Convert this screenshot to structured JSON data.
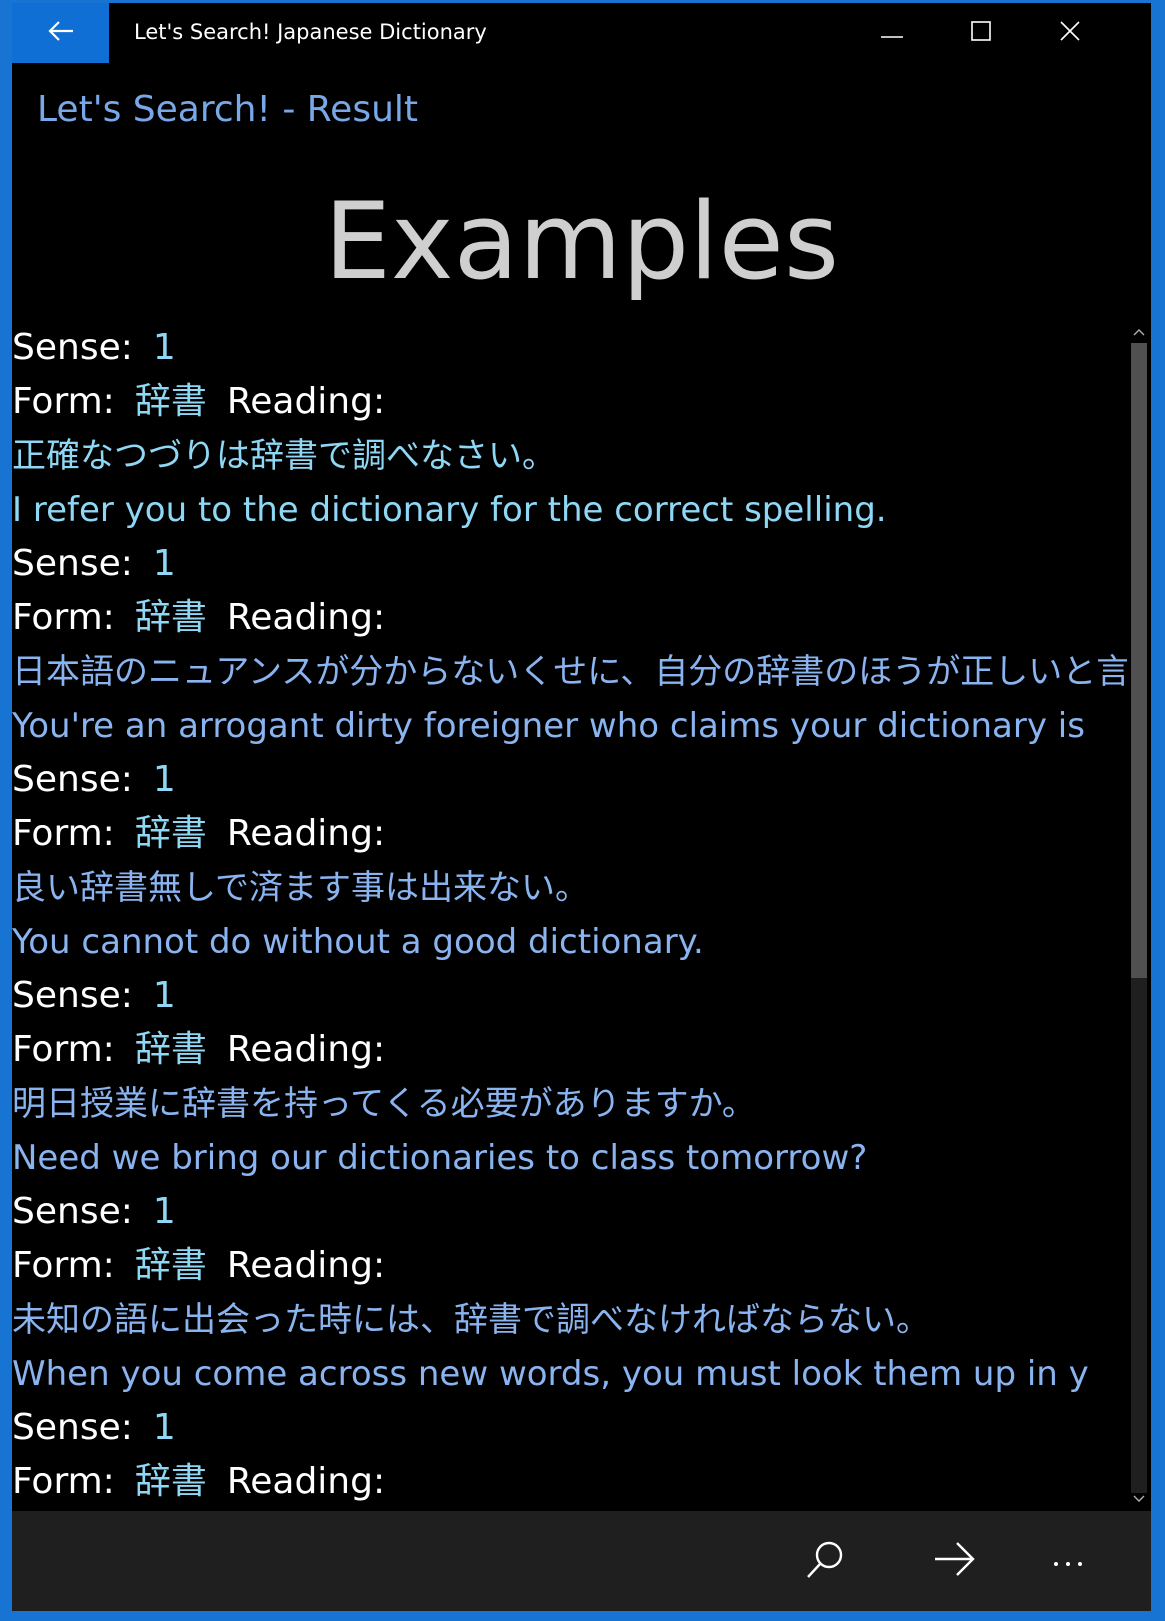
{
  "window": {
    "title": "Let's Search! Japanese Dictionary",
    "accent_color": "#0f6fd4",
    "caption_buttons": [
      "minimize-icon",
      "maximize-icon",
      "close-icon"
    ]
  },
  "app": {
    "header": "Let's Search! - Result",
    "heading": "Examples"
  },
  "labels": {
    "sense": "Sense:",
    "form": "Form:",
    "reading": "Reading:"
  },
  "examples": [
    {
      "sense": "1",
      "form": "辞書",
      "japanese": "正確なつづりは辞書で調べなさい。",
      "english": "I refer you to the dictionary for the correct spelling."
    },
    {
      "sense": "1",
      "form": "辞書",
      "japanese": "日本語のニュアンスが分からないくせに、自分の辞書のほうが正しいと言い",
      "english": "You're an arrogant dirty foreigner who claims your dictionary is"
    },
    {
      "sense": "1",
      "form": "辞書",
      "japanese": "良い辞書無しで済ます事は出来ない。",
      "english": "You cannot do without a good dictionary."
    },
    {
      "sense": "1",
      "form": "辞書",
      "japanese": "明日授業に辞書を持ってくる必要がありますか。",
      "english": "Need we bring our dictionaries to class tomorrow?"
    },
    {
      "sense": "1",
      "form": "辞書",
      "japanese": "未知の語に出会った時には、辞書で調べなければならない。",
      "english": "When you come across new words, you must look them up in y"
    },
    {
      "sense": "1",
      "form": "辞書"
    }
  ],
  "appbar": {
    "buttons": [
      "search-icon",
      "forward-arrow-icon",
      "more-icon"
    ]
  }
}
